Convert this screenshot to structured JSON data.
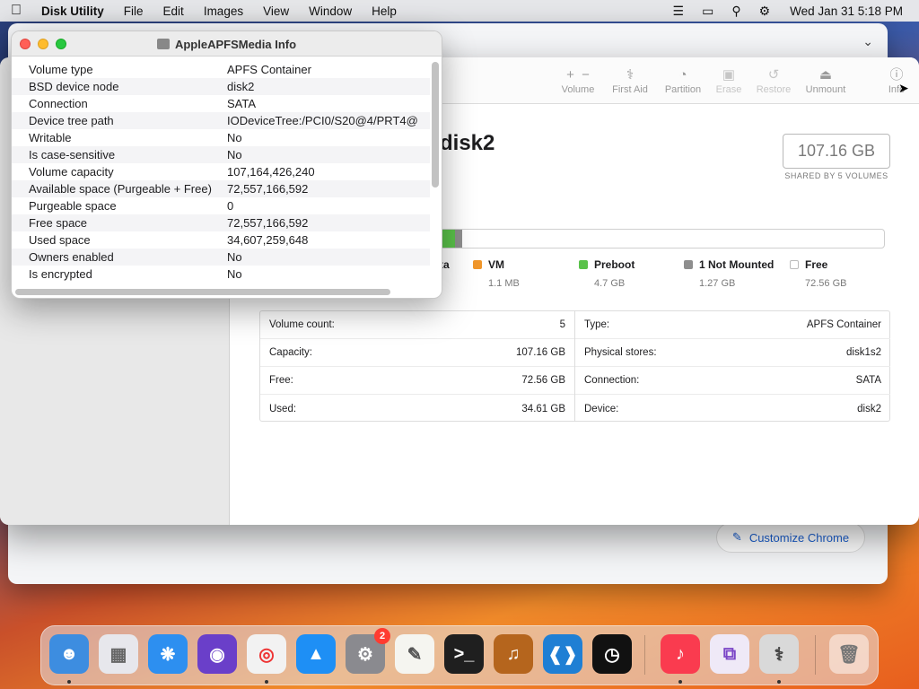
{
  "menubar": {
    "app_name": "Disk Utility",
    "menus": [
      "File",
      "Edit",
      "Images",
      "View",
      "Window",
      "Help"
    ],
    "clock": "Wed Jan 31  5:18 PM"
  },
  "chrome": {
    "customize_label": "Customize Chrome"
  },
  "disk_utility": {
    "toolbar": {
      "volume": "Volume",
      "first_aid": "First Aid",
      "partition": "Partition",
      "erase": "Erase",
      "restore": "Restore",
      "unmount": "Unmount",
      "info": "Info"
    },
    "title": "disk2",
    "size": "107.16 GB",
    "shared_caption": "SHARED BY 5 VOLUMES",
    "legend_cut": "ta",
    "legend": [
      {
        "name": "VM",
        "value": "1.1 MB",
        "color": "#f0962a"
      },
      {
        "name": "Preboot",
        "value": "4.7 GB",
        "color": "#5ac24a"
      },
      {
        "name": "1 Not Mounted",
        "value": "1.27 GB",
        "color": "#8e8e8e"
      },
      {
        "name": "Free",
        "value": "72.56 GB",
        "color": "#ffffff"
      }
    ],
    "details_left": [
      {
        "label": "Volume count:",
        "value": "5"
      },
      {
        "label": "Capacity:",
        "value": "107.16 GB"
      },
      {
        "label": "Free:",
        "value": "72.56 GB"
      },
      {
        "label": "Used:",
        "value": "34.61 GB"
      }
    ],
    "details_right": [
      {
        "label": "Type:",
        "value": "APFS Container"
      },
      {
        "label": "Physical stores:",
        "value": "disk1s2"
      },
      {
        "label": "Connection:",
        "value": "SATA"
      },
      {
        "label": "Device:",
        "value": "disk2"
      }
    ]
  },
  "info_panel": {
    "title": "AppleAPFSMedia Info",
    "rows": [
      {
        "key": "Volume type",
        "value": "APFS Container"
      },
      {
        "key": "BSD device node",
        "value": "disk2"
      },
      {
        "key": "Connection",
        "value": "SATA"
      },
      {
        "key": "Device tree path",
        "value": "IODeviceTree:/PCI0/S20@4/PRT4@"
      },
      {
        "key": "Writable",
        "value": "No"
      },
      {
        "key": "Is case-sensitive",
        "value": "No"
      },
      {
        "key": "Volume capacity",
        "value": "107,164,426,240"
      },
      {
        "key": "Available space (Purgeable + Free)",
        "value": "72,557,166,592"
      },
      {
        "key": "Purgeable space",
        "value": "0"
      },
      {
        "key": "Free space",
        "value": "72,557,166,592"
      },
      {
        "key": "Used space",
        "value": "34,607,259,648"
      },
      {
        "key": "Owners enabled",
        "value": "No"
      },
      {
        "key": "Is encrypted",
        "value": "No"
      }
    ]
  },
  "dock": {
    "settings_badge": "2"
  }
}
